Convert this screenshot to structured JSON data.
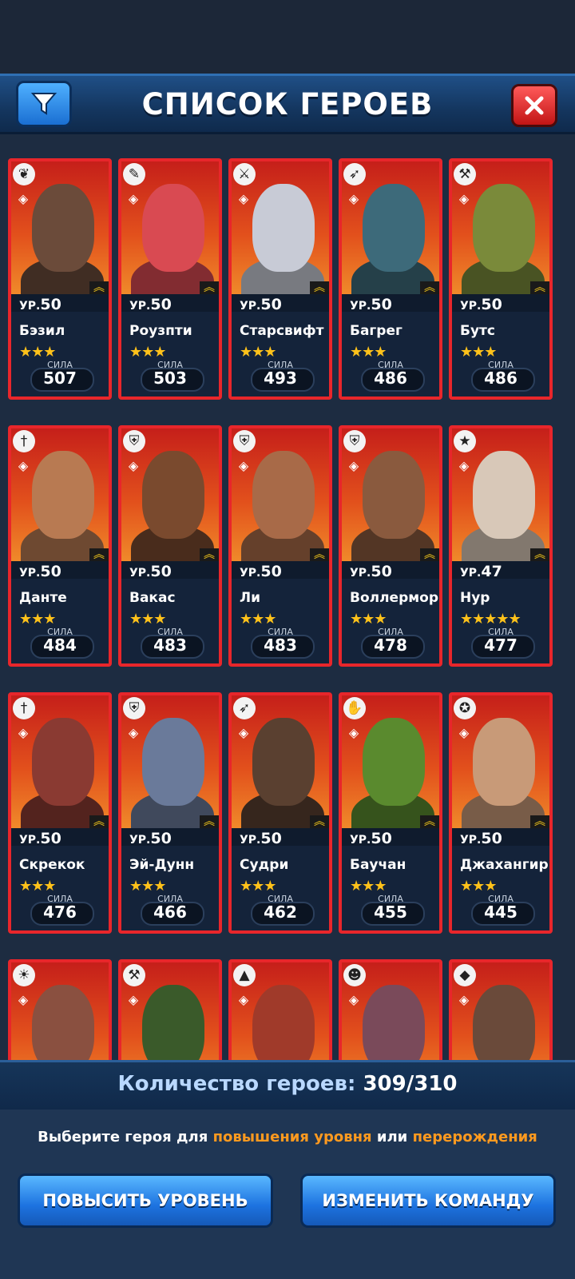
{
  "header": {
    "title": "СПИСОК ГЕРОЕВ",
    "filter_icon": "funnel-icon",
    "close_icon": "close-icon"
  },
  "level_prefix": "УР.",
  "power_label": "СИЛА",
  "heroes": [
    {
      "name": "Бэзил",
      "level": "50",
      "stars": "★★★",
      "power": "507",
      "class_icon": "leaf-icon",
      "portrait": "#6b4b3a"
    },
    {
      "name": "Роузпти",
      "level": "50",
      "stars": "★★★",
      "power": "503",
      "class_icon": "book-icon",
      "portrait": "#d94a52"
    },
    {
      "name": "Старсвифт",
      "level": "50",
      "stars": "★★★",
      "power": "493",
      "class_icon": "swords-icon",
      "portrait": "#c8cbd6"
    },
    {
      "name": "Багрег",
      "level": "50",
      "stars": "★★★",
      "power": "486",
      "class_icon": "bow-icon",
      "portrait": "#3d6a7a"
    },
    {
      "name": "Бутс",
      "level": "50",
      "stars": "★★★",
      "power": "486",
      "class_icon": "axe-icon",
      "portrait": "#7a8a3a"
    },
    {
      "name": "Данте",
      "level": "50",
      "stars": "★★★",
      "power": "484",
      "class_icon": "dagger-icon",
      "portrait": "#b87a52"
    },
    {
      "name": "Вакас",
      "level": "50",
      "stars": "★★★",
      "power": "483",
      "class_icon": "shield-icon",
      "portrait": "#7a4a2e"
    },
    {
      "name": "Ли",
      "level": "50",
      "stars": "★★★",
      "power": "483",
      "class_icon": "shield-icon",
      "portrait": "#a86a48"
    },
    {
      "name": "Воллерморк",
      "level": "50",
      "stars": "★★★",
      "power": "478",
      "class_icon": "shield-icon",
      "portrait": "#8a5a3e"
    },
    {
      "name": "Нур",
      "level": "47",
      "stars": "★★★★★",
      "power": "477",
      "class_icon": "star-2020-icon",
      "portrait": "#d8c8b8"
    },
    {
      "name": "Скрекок",
      "level": "50",
      "stars": "★★★",
      "power": "476",
      "class_icon": "dagger-icon",
      "portrait": "#8a3a32"
    },
    {
      "name": "Эй-Дунн",
      "level": "50",
      "stars": "★★★",
      "power": "466",
      "class_icon": "shield-icon",
      "portrait": "#6a7a9a"
    },
    {
      "name": "Судри",
      "level": "50",
      "stars": "★★★",
      "power": "462",
      "class_icon": "bow-icon",
      "portrait": "#5a4030"
    },
    {
      "name": "Баучан",
      "level": "50",
      "stars": "★★★",
      "power": "455",
      "class_icon": "hand-icon",
      "portrait": "#5a8a2e"
    },
    {
      "name": "Джахангир",
      "level": "50",
      "stars": "★★★",
      "power": "445",
      "class_icon": "pentagram-icon",
      "portrait": "#c89a78"
    },
    {
      "name": "",
      "level": "",
      "stars": "",
      "power": "",
      "class_icon": "sun-icon",
      "portrait": "#8a5040"
    },
    {
      "name": "",
      "level": "",
      "stars": "",
      "power": "",
      "class_icon": "axe-icon",
      "portrait": "#3a5a2a"
    },
    {
      "name": "",
      "level": "",
      "stars": "",
      "power": "",
      "class_icon": "triangle-icon",
      "portrait": "#a03a2a"
    },
    {
      "name": "",
      "level": "",
      "stars": "",
      "power": "",
      "class_icon": "mask-icon",
      "portrait": "#7a4a5a"
    },
    {
      "name": "",
      "level": "",
      "stars": "",
      "power": "",
      "class_icon": "gem-icon",
      "portrait": "#6a4a3a"
    }
  ],
  "footer": {
    "count_label": "Количество героев:",
    "count_value": "309/310",
    "hint_part1": "Выберите героя для",
    "hint_hl1": "повышения уровня",
    "hint_part2": "или",
    "hint_hl2": "перерождения",
    "btn_level_up": "ПОВЫСИТЬ УРОВЕНЬ",
    "btn_change_team": "ИЗМЕНИТЬ КОМАНДУ"
  },
  "colors": {
    "card_border": "#e8262b",
    "accent_orange": "#ff9a1f",
    "button_blue": "#1d73e0",
    "star_gold": "#ffc21a"
  }
}
